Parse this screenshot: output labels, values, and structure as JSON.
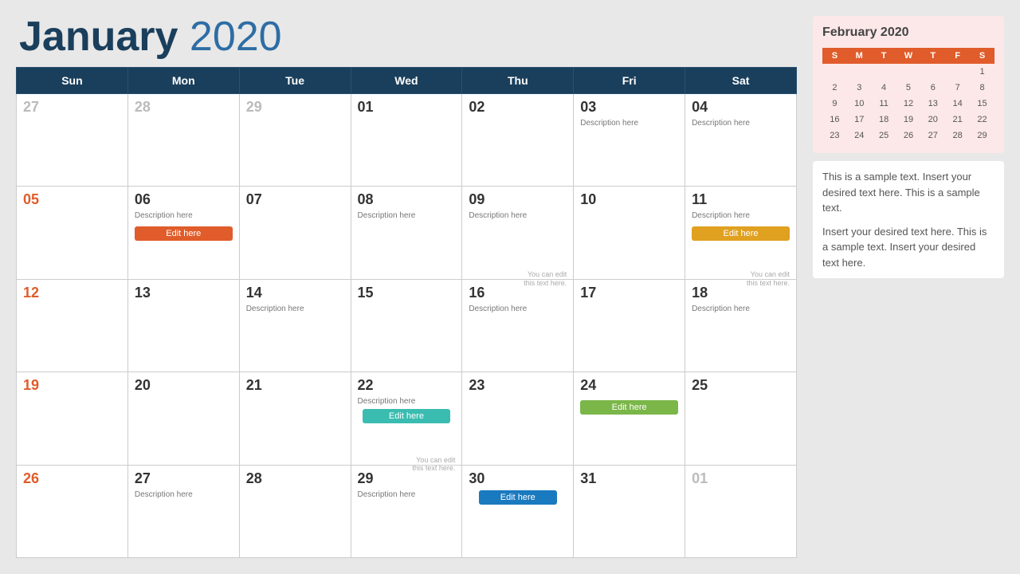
{
  "title": {
    "bold": "January",
    "light": " 2020"
  },
  "headers": [
    "Sun",
    "Mon",
    "Tue",
    "Wed",
    "Thu",
    "Fri",
    "Sat"
  ],
  "weeks": [
    [
      {
        "num": "27",
        "type": "other-month"
      },
      {
        "num": "28",
        "type": "other-month"
      },
      {
        "num": "29",
        "type": "other-month"
      },
      {
        "num": "01",
        "type": "normal"
      },
      {
        "num": "02",
        "type": "normal"
      },
      {
        "num": "03",
        "type": "normal",
        "desc": "Description here"
      },
      {
        "num": "04",
        "type": "normal",
        "desc": "Description here"
      }
    ],
    [
      {
        "num": "05",
        "type": "sunday"
      },
      {
        "num": "06",
        "type": "normal",
        "desc": "Description here",
        "btn": "Edit here",
        "btnClass": "btn-orange"
      },
      {
        "num": "07",
        "type": "normal"
      },
      {
        "num": "08",
        "type": "normal",
        "desc": "Description here"
      },
      {
        "num": "09",
        "type": "normal",
        "desc": "Description here"
      },
      {
        "num": "10",
        "type": "normal"
      },
      {
        "num": "11",
        "type": "normal",
        "desc": "Description here",
        "btn": "Edit here",
        "btnClass": "btn-yellow"
      }
    ],
    [
      {
        "num": "12",
        "type": "sunday"
      },
      {
        "num": "13",
        "type": "normal"
      },
      {
        "num": "14",
        "type": "normal",
        "desc": "Description here"
      },
      {
        "num": "15",
        "type": "normal"
      },
      {
        "num": "16",
        "type": "normal",
        "note": "You can edit this text here.",
        "desc": "Description here"
      },
      {
        "num": "17",
        "type": "normal"
      },
      {
        "num": "18",
        "type": "normal",
        "note": "You can edit this text here.",
        "desc": "Description here"
      }
    ],
    [
      {
        "num": "19",
        "type": "sunday"
      },
      {
        "num": "20",
        "type": "normal"
      },
      {
        "num": "21",
        "type": "normal"
      },
      {
        "num": "22",
        "type": "normal",
        "desc": "Description here",
        "btn": "Edit here",
        "btnClass": "btn-teal"
      },
      {
        "num": "23",
        "type": "normal"
      },
      {
        "num": "24",
        "type": "normal",
        "btn": "Edit here",
        "btnClass": "btn-green"
      },
      {
        "num": "25",
        "type": "normal"
      }
    ],
    [
      {
        "num": "26",
        "type": "sunday"
      },
      {
        "num": "27",
        "type": "normal",
        "desc": "Description here"
      },
      {
        "num": "28",
        "type": "normal"
      },
      {
        "num": "29",
        "type": "normal",
        "note": "You can edit this text here.",
        "desc": "Description here"
      },
      {
        "num": "30",
        "type": "normal",
        "btn": "Edit here",
        "btnClass": "btn-blue"
      },
      {
        "num": "31",
        "type": "normal"
      },
      {
        "num": "01",
        "type": "other-month"
      }
    ]
  ],
  "sidebar": {
    "mini_title": "February 2020",
    "mini_headers": [
      "S",
      "M",
      "T",
      "W",
      "T",
      "F",
      "S"
    ],
    "mini_weeks": [
      [
        "",
        "",
        "",
        "",
        "",
        "",
        "1"
      ],
      [
        "2",
        "3",
        "4",
        "5",
        "6",
        "7",
        "8"
      ],
      [
        "9",
        "10",
        "11",
        "12",
        "13",
        "14",
        "15"
      ],
      [
        "16",
        "17",
        "18",
        "19",
        "20",
        "21",
        "22"
      ],
      [
        "23",
        "24",
        "25",
        "26",
        "27",
        "28",
        "29"
      ],
      [
        "",
        "",
        "",
        "",
        "",
        "",
        ""
      ]
    ],
    "text1": "This is a sample text. Insert your desired text here. This is a sample text.",
    "text2": "Insert your desired text here. This is a sample text. Insert your desired text here."
  }
}
